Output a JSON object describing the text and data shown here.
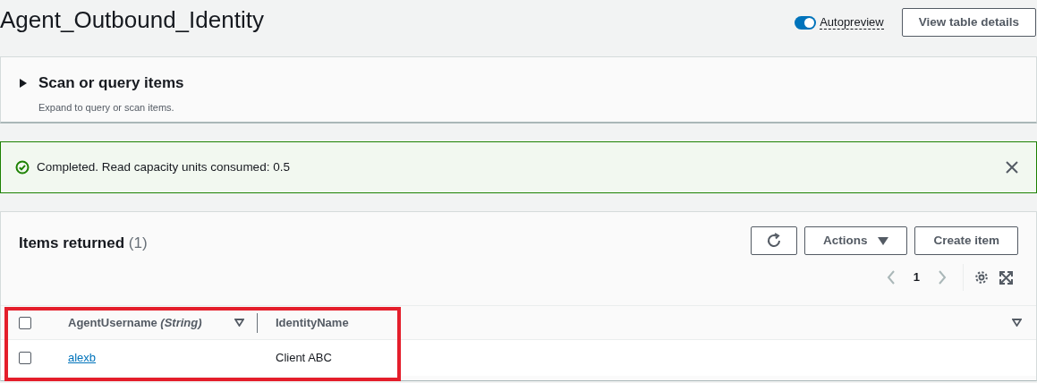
{
  "header": {
    "title": "Agent_Outbound_Identity",
    "autopreview": {
      "label": "Autopreview",
      "on": true
    },
    "button": "View table details"
  },
  "scan_panel": {
    "title": "Scan or query items",
    "description": "Expand to query or scan items.",
    "expanded": false
  },
  "alert": {
    "message": "Completed. Read capacity units consumed: 0.5"
  },
  "items": {
    "title": "Items returned",
    "count": "(1)",
    "actions": "Actions",
    "create": "Create item",
    "page": "1",
    "table": {
      "highlighted": true,
      "select_all_checked": false,
      "columns": [
        {
          "label": "AgentUsername",
          "type": "(String)"
        },
        {
          "label": "IdentityName"
        }
      ],
      "rows": [
        {
          "checked": false,
          "cells": [
            "alexb",
            "Client ABC"
          ]
        }
      ]
    }
  }
}
